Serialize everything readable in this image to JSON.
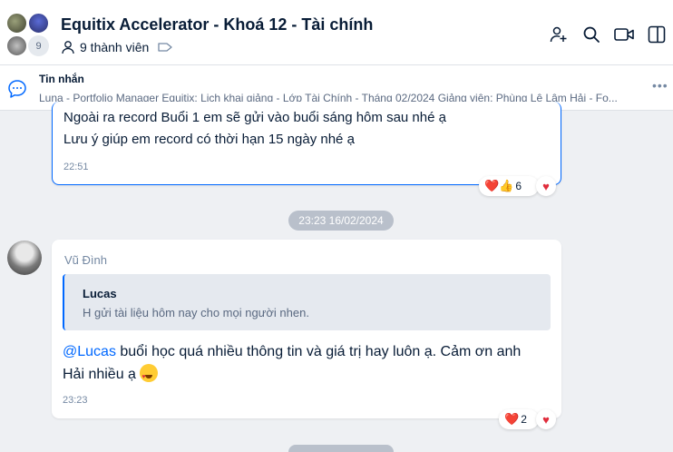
{
  "header": {
    "title": "Equitix Accelerator - Khoá 12 - Tài chính",
    "member_count_badge": "9",
    "members_label": "9 thành viên",
    "icons": [
      "person-add-icon",
      "search-icon",
      "video-call-icon",
      "sidebar-toggle-icon"
    ]
  },
  "pinned": {
    "title": "Tin nhắn",
    "text": "Luna - Portfolio Manager Equitix: Lịch khai giảng - Lớp Tài Chính - Tháng 02/2024  Giảng viên: Phùng Lê Lâm Hải - Fo...",
    "more": "•••"
  },
  "messages": [
    {
      "lines": [
        "Ngoài ra record Buổi 1 em sẽ gửi vào buổi sáng hôm sau nhé ạ",
        "Lưu ý giúp em record có thời hạn 15 ngày nhé ạ"
      ],
      "time": "22:51",
      "reactions": {
        "emojis": "❤️👍",
        "count": "6"
      }
    },
    {
      "date_divider": "23:23 16/02/2024",
      "sender": "Vũ Đình",
      "quote": {
        "name": "Lucas",
        "text": "H gửi tài liệu hôm nay cho mọi người nhen."
      },
      "mention": "@Lucas",
      "text": " buổi học quá nhiều thông tin và giá trị hay luôn ạ. Cảm ơn anh Hải nhiều ạ",
      "time": "23:23",
      "reactions": {
        "emojis": "❤️",
        "count": "2"
      }
    }
  ],
  "colors": {
    "accent": "#0068ff",
    "heart": "#e02d3c",
    "background": "#eef0f3"
  }
}
